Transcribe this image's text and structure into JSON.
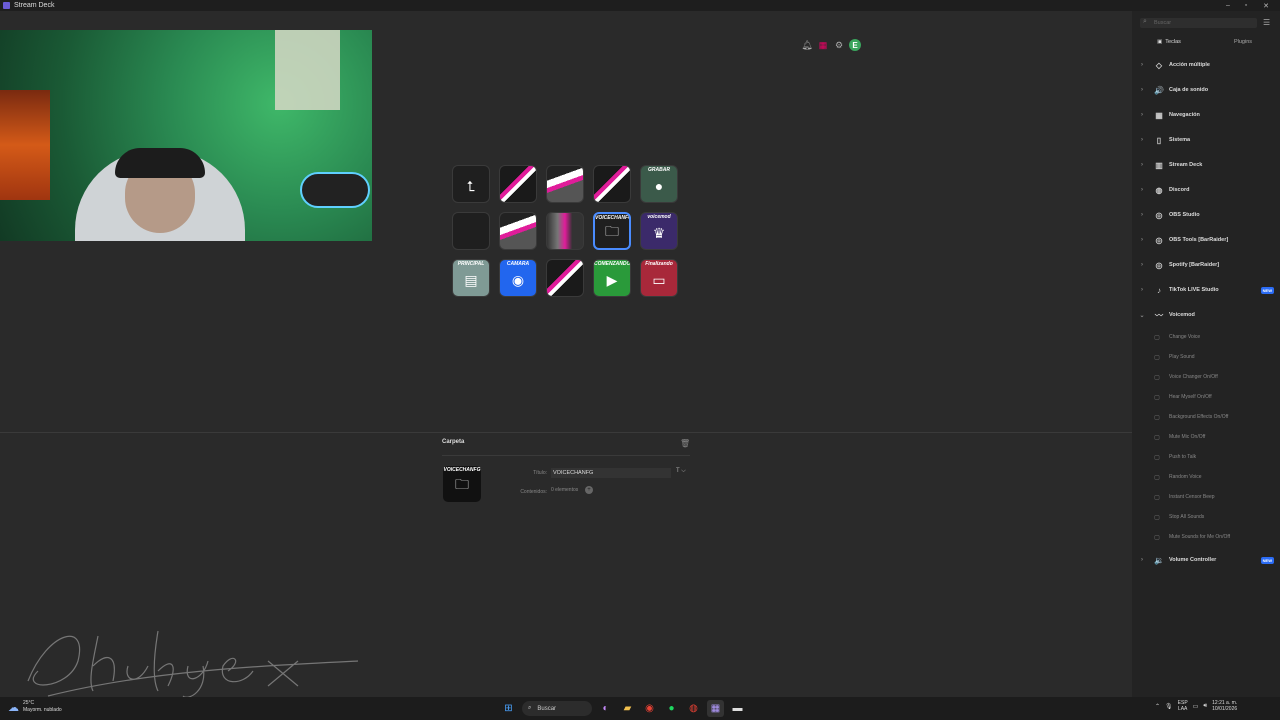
{
  "window": {
    "title": "Stream Deck",
    "min": "–",
    "max": "▫",
    "close": "✕"
  },
  "top_icons": {
    "avatar_letter": "E"
  },
  "keys": [
    {
      "label": "",
      "glyph": "⮤",
      "style": "back"
    },
    {
      "label": "",
      "glyph": "",
      "style": "stripe"
    },
    {
      "label": "",
      "glyph": "",
      "style": "stripe2"
    },
    {
      "label": "",
      "glyph": "",
      "style": "stripe"
    },
    {
      "label": "GRABAR",
      "glyph": "●",
      "style": "grabar"
    },
    {
      "label": "",
      "glyph": "",
      "style": "empty"
    },
    {
      "label": "",
      "glyph": "",
      "style": "stripe2"
    },
    {
      "label": "",
      "glyph": "",
      "style": "arrow"
    },
    {
      "label": "VOICECHANFG",
      "glyph": "🗀",
      "style": "selected"
    },
    {
      "label": "voicemod",
      "glyph": "♛",
      "style": "voicemod"
    },
    {
      "label": "PRINCIPAL",
      "glyph": "▤",
      "style": "principal"
    },
    {
      "label": "CAMARA",
      "glyph": "◉",
      "style": "camara"
    },
    {
      "label": "",
      "glyph": "",
      "style": "stripe"
    },
    {
      "label": "COMENZANDO",
      "glyph": "▶",
      "style": "comenzando"
    },
    {
      "label": "Finalizando",
      "glyph": "▭",
      "style": "finalizando"
    }
  ],
  "inspector": {
    "title": "Carpeta",
    "key_label": "VOICECHANFG",
    "title_label": "Título:",
    "title_value": "VOICECHANFG",
    "title_format": "T ⌵",
    "contents_label": "Contenidos:",
    "contents_value": "0 elementos",
    "contents_btn": "+"
  },
  "watermark": "Chukyex",
  "sidebar": {
    "search_placeholder": "Buscar",
    "tabs": [
      "Teclas",
      "Plugins"
    ],
    "categories": [
      {
        "label": "Acción múltiple",
        "icon": "◇",
        "expanded": false
      },
      {
        "label": "Caja de sonido",
        "icon": "🔊",
        "expanded": false
      },
      {
        "label": "Navegación",
        "icon": "▦",
        "expanded": false
      },
      {
        "label": "Sistema",
        "icon": "▯",
        "expanded": false
      },
      {
        "label": "Stream Deck",
        "icon": "▥",
        "expanded": false
      },
      {
        "label": "Discord",
        "icon": "◍",
        "expanded": false
      },
      {
        "label": "OBS Studio",
        "icon": "◎",
        "expanded": false
      },
      {
        "label": "OBS Tools [BarRaider]",
        "icon": "◎",
        "expanded": false
      },
      {
        "label": "Spotify [BarRaider]",
        "icon": "◎",
        "expanded": false
      },
      {
        "label": "TikTok LIVE Studio",
        "icon": "♪",
        "expanded": false,
        "badge": "NEW"
      },
      {
        "label": "Voicemod",
        "icon": "〰",
        "expanded": true
      },
      {
        "label": "Volume Controller",
        "icon": "🔉",
        "expanded": false,
        "badge": "NEW"
      }
    ],
    "voicemod_items": [
      "Change Voice",
      "Play Sound",
      "Voice Changer On/Off",
      "Hear Myself On/Off",
      "Background Effects On/Off",
      "Mute Mic On/Off",
      "Push to Talk",
      "Random Voice",
      "Instant Censor Beep",
      "Stop All Sounds",
      "Mute Sounds for Me On/Off"
    ]
  },
  "taskbar": {
    "temp": "25°C",
    "weather": "Mayorm. nublado",
    "search": "Buscar",
    "lang1": "ESP",
    "lang2": "LAA",
    "time": "12:21 a. m.",
    "date": "10/01/2026"
  }
}
